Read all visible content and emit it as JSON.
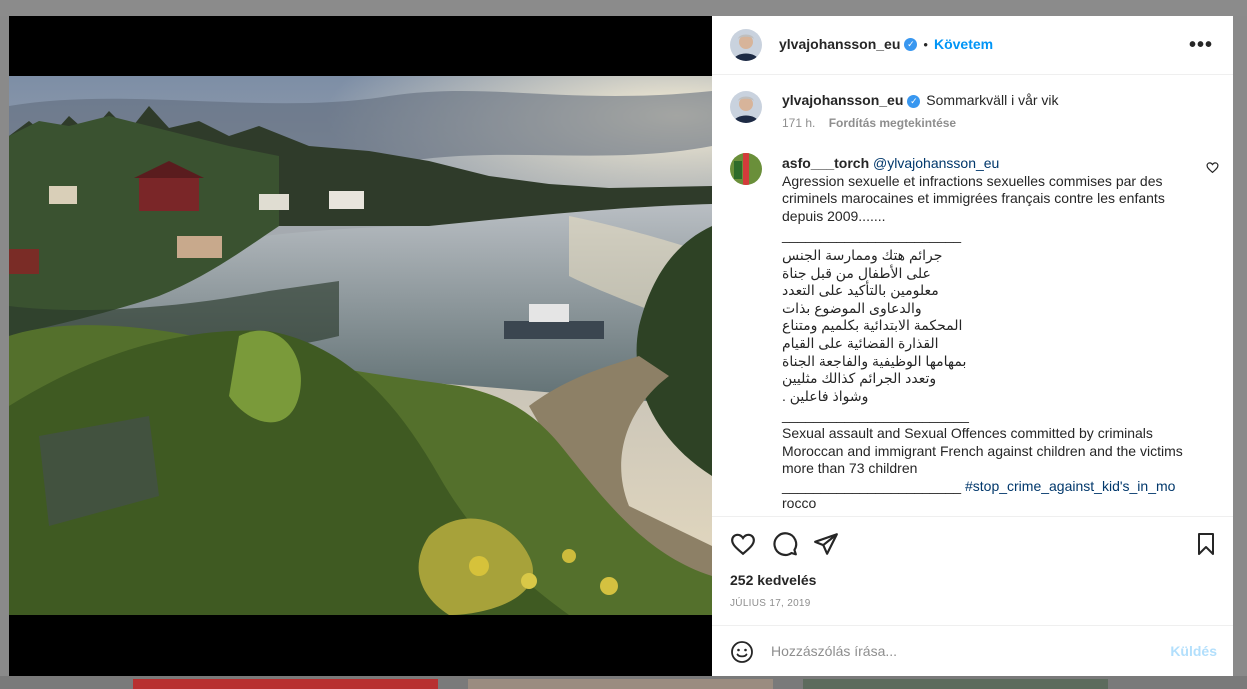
{
  "post": {
    "author": "ylvajohansson_eu",
    "follow_label": "Követem",
    "more_label": "•••",
    "caption_text": "Sommarkväll i vår vik",
    "caption_age": "171 h.",
    "translate_label": "Fordítás megtekintése"
  },
  "comment": {
    "author": "asfo___torch",
    "mention": "@ylvajohansson_eu",
    "french": "Agression sexuelle et infractions sexuelles commises par des criminels marocaines et immigrées français contre les enfants depuis 2009.......",
    "separator1": "_______________________",
    "arabic": [
      "جرائم هتك وممارسة الجنس",
      "على الأطفال من قبل جناة",
      "معلومين بالتأكيد على التعدد",
      "والدعاوى الموضوع بذات",
      "المحكمة الابتدائية بكلميم ومتناع",
      "القذارة القضائية على القيام",
      "بمهامها الوظيفية والفاجعة الجناة",
      "وتعدد الجرائم كذالك مثليين",
      "وشواذ فاعلين ."
    ],
    "separator2": "________________________",
    "english": "Sexual assault and Sexual Offences committed by criminals Moroccan and immigrant French against children and the victims more than 73 children",
    "separator3": "_______________________",
    "hashtag_part1": "#stop_crime_against_kid's_in_mo",
    "hashtag_part2": "rocco"
  },
  "stats": {
    "likes": "252 kedvelés",
    "date": "JÚLIUS 17, 2019"
  },
  "add_comment": {
    "placeholder": "Hozzászólás írása...",
    "post_label": "Küldés"
  },
  "colors": {
    "verified": "#3897f0",
    "follow": "#0095f6",
    "post_disabled": "#b2dffc",
    "link": "#00376b"
  },
  "icons": [
    "verified-badge-icon",
    "more-options-icon",
    "heart-icon",
    "comment-icon",
    "share-icon",
    "bookmark-icon",
    "emoji-icon"
  ]
}
